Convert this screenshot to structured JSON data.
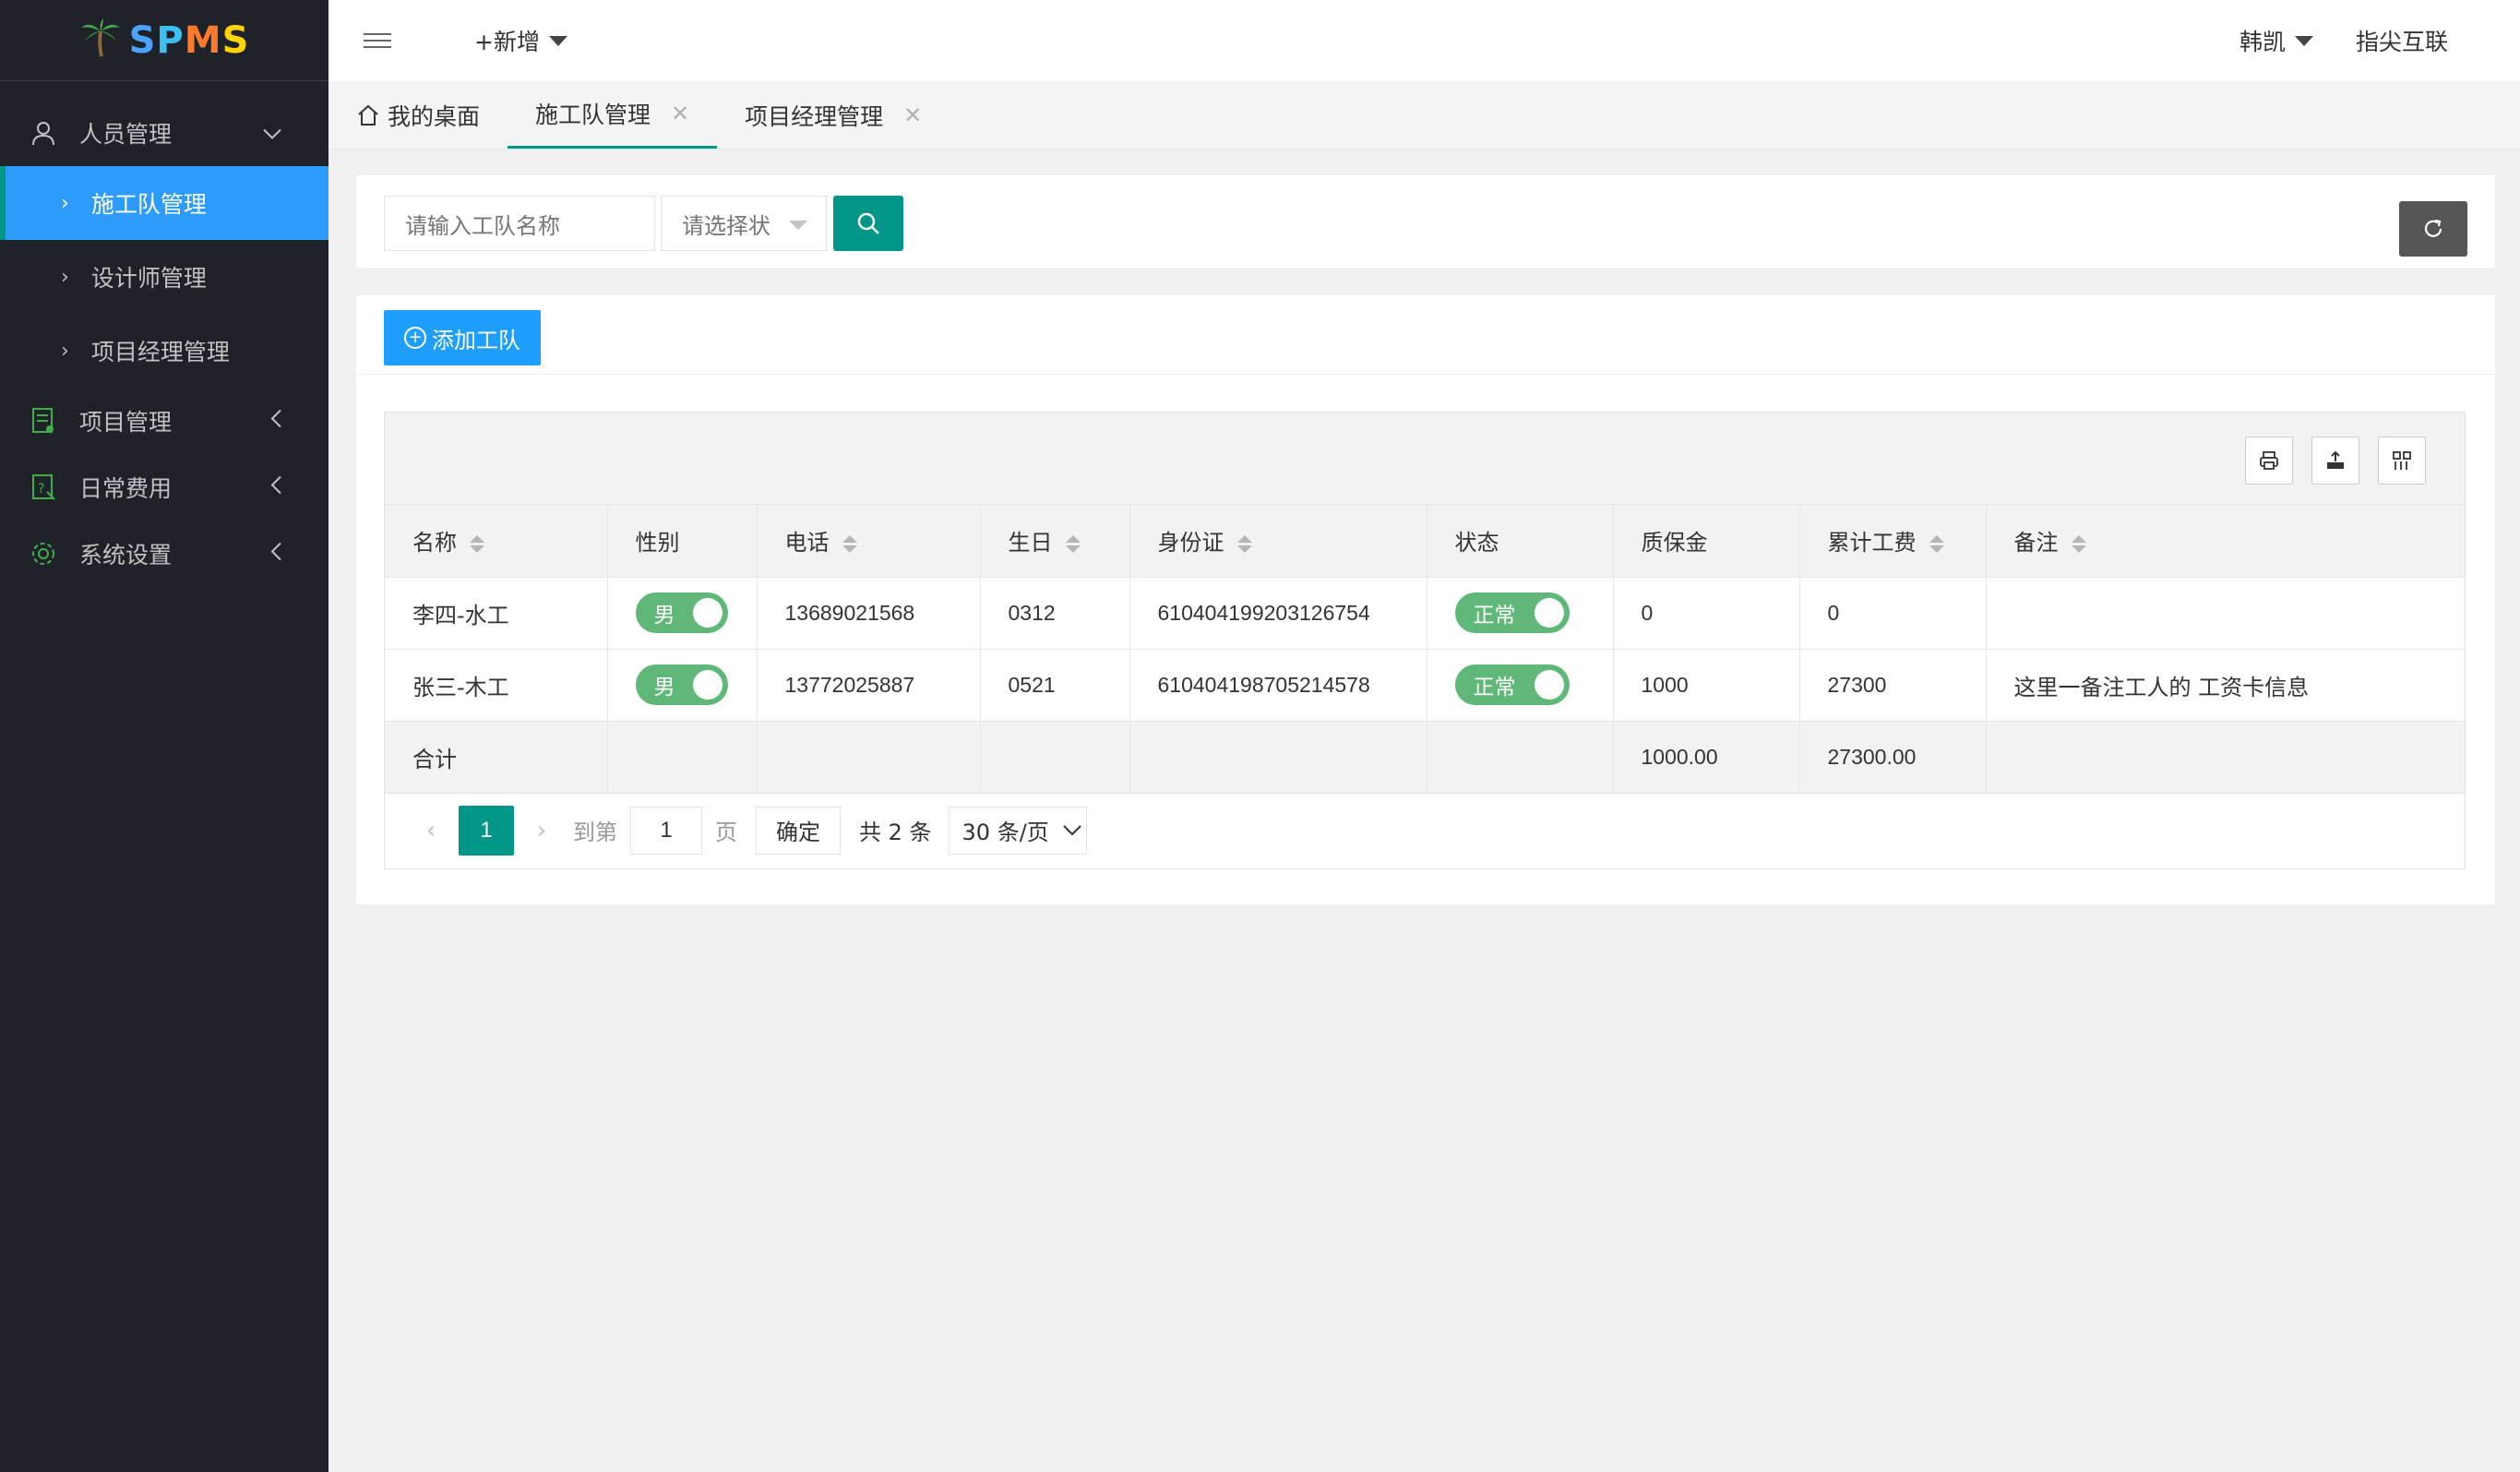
{
  "app": {
    "logo_text": [
      "S",
      "P",
      "M",
      "S"
    ]
  },
  "sidebar": {
    "groups": [
      {
        "label": "人员管理",
        "icon": "user-icon",
        "expanded": true,
        "items": [
          {
            "label": "施工队管理",
            "active": true
          },
          {
            "label": "设计师管理",
            "active": false
          },
          {
            "label": "项目经理管理",
            "active": false
          }
        ]
      },
      {
        "label": "项目管理",
        "icon": "project-icon",
        "expanded": false
      },
      {
        "label": "日常费用",
        "icon": "expense-icon",
        "expanded": false
      },
      {
        "label": "系统设置",
        "icon": "gear-icon",
        "expanded": false
      }
    ]
  },
  "header": {
    "new_label": "+新增",
    "user_name": "韩凯",
    "org_name": "指尖互联"
  },
  "tabs": [
    {
      "label": "我的桌面",
      "home": true
    },
    {
      "label": "施工队管理",
      "active": true,
      "closable": true
    },
    {
      "label": "项目经理管理",
      "closable": true
    }
  ],
  "search": {
    "name_placeholder": "请输入工队名称",
    "status_placeholder": "请选择状"
  },
  "toolbar": {
    "add_label": "添加工队"
  },
  "table": {
    "columns": [
      "名称",
      "性别",
      "电话",
      "生日",
      "身份证",
      "状态",
      "质保金",
      "累计工费",
      "备注"
    ],
    "rows": [
      {
        "name": "李四-水工",
        "gender": "男",
        "phone": "13689021568",
        "birthday": "0312",
        "id_card": "610404199203126754",
        "status": "正常",
        "deposit": "0",
        "total_pay": "0",
        "remark": ""
      },
      {
        "name": "张三-木工",
        "gender": "男",
        "phone": "13772025887",
        "birthday": "0521",
        "id_card": "610404198705214578",
        "status": "正常",
        "deposit": "1000",
        "total_pay": "27300",
        "remark": "这里一备注工人的 工资卡信息"
      }
    ],
    "total": {
      "label": "合计",
      "deposit": "1000.00",
      "total_pay": "27300.00"
    }
  },
  "pagination": {
    "current_page": "1",
    "goto_label": "到第",
    "goto_value": "1",
    "page_unit": "页",
    "confirm_label": "确定",
    "total_text": "共 2 条",
    "page_size": "30 条/页"
  },
  "colors": {
    "sidebar_bg": "#20222a",
    "active_nav": "#2d9cfc",
    "primary": "#009688",
    "add_button": "#1e9fff",
    "switch_on": "#5fb878"
  }
}
